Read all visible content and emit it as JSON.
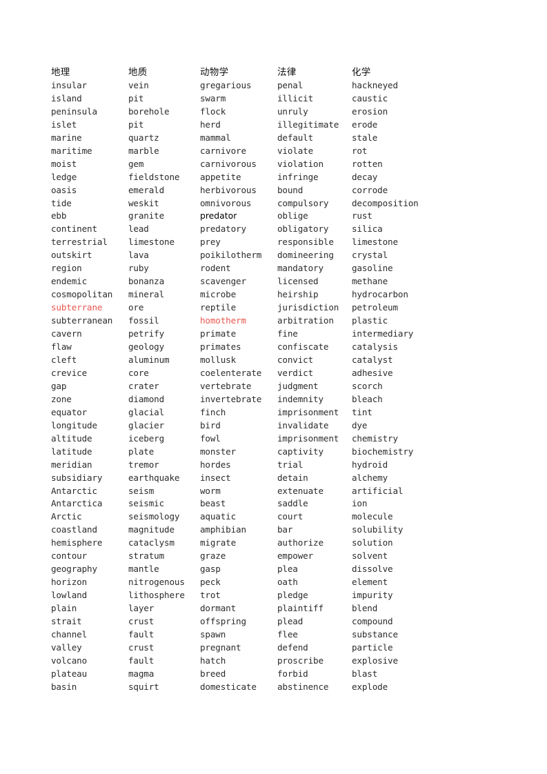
{
  "page": {
    "background_color": "#ffffff",
    "text_color": "#2b2b2b",
    "accent_red": "#e8564e",
    "column_count": 5,
    "row_count": 48
  },
  "columns": [
    {
      "header": "地理",
      "words": [
        "insular",
        "island",
        "peninsula",
        "islet",
        "marine",
        "maritime",
        "moist",
        "ledge",
        "oasis",
        "tide",
        "ebb",
        "continent",
        "terrestrial",
        "outskirt",
        "region",
        "endemic",
        "cosmopolitan",
        "subterrane",
        "subterranean",
        "cavern",
        "flaw",
        "cleft",
        "crevice",
        "gap",
        "zone",
        "equator",
        "longitude",
        "altitude",
        "latitude",
        "meridian",
        "subsidiary",
        "Antarctic",
        "Antarctica",
        "Arctic",
        "coastland",
        "hemisphere",
        "contour",
        "geography",
        "horizon",
        "lowland",
        "plain",
        "strait",
        "channel",
        "valley",
        "volcano",
        "plateau",
        "basin",
        ""
      ]
    },
    {
      "header": "地质",
      "words": [
        "vein",
        "pit",
        "borehole",
        "pit",
        "quartz",
        "marble",
        "gem",
        "fieldstone",
        "emerald",
        "weskit",
        "granite",
        "lead",
        "limestone",
        "lava",
        "ruby",
        "bonanza",
        "mineral",
        "ore",
        "fossil",
        "petrify",
        "geology",
        "aluminum",
        "core",
        "crater",
        "diamond",
        "glacial",
        "glacier",
        "iceberg",
        "plate",
        "tremor",
        "earthquake",
        "seism",
        "seismic",
        "seismology",
        "magnitude",
        "cataclysm",
        "stratum",
        "mantle",
        "nitrogenous",
        "lithosphere",
        "layer",
        "crust",
        "fault",
        "crust",
        "fault",
        "magma",
        "squirt",
        ""
      ]
    },
    {
      "header": "动物学",
      "words": [
        "gregarious",
        "swarm",
        "flock",
        "herd",
        "mammal",
        "carnivore",
        "carnivorous",
        "appetite",
        "herbivorous",
        "omnivorous",
        "predator",
        "predatory",
        "prey",
        "poikilotherm",
        "rodent",
        "scavenger",
        "microbe",
        "reptile",
        "homotherm",
        "primate",
        "primates",
        "mollusk",
        "coelenterate",
        "vertebrate",
        "invertebrate",
        "finch",
        "bird",
        "fowl",
        "monster",
        "hordes",
        "insect",
        "worm",
        "beast",
        "aquatic",
        "amphibian",
        "migrate",
        "graze",
        "gasp",
        "peck",
        "trot",
        "dormant",
        "offspring",
        "spawn",
        "pregnant",
        "hatch",
        "breed",
        "domesticate",
        ""
      ]
    },
    {
      "header": "法律",
      "words": [
        "penal",
        "illicit",
        "unruly",
        "illegitimate",
        "default",
        "violate",
        "violation",
        "infringe",
        "bound",
        "compulsory",
        "oblige",
        "obligatory",
        "responsible",
        "domineering",
        "mandatory",
        "licensed",
        "heirship",
        "jurisdiction",
        "arbitration",
        "fine",
        "confiscate",
        "convict",
        "verdict",
        "judgment",
        "indemnity",
        "imprisonment",
        "invalidate",
        "imprisonment",
        "captivity",
        "trial",
        "detain",
        "extenuate",
        "saddle",
        "court",
        "bar",
        "authorize",
        "empower",
        "plea",
        "oath",
        "pledge",
        "plaintiff",
        "plead",
        "flee",
        "defend",
        "proscribe",
        "forbid",
        "abstinence",
        ""
      ]
    },
    {
      "header": "化学",
      "words": [
        "hackneyed",
        "caustic",
        "erosion",
        "erode",
        "stale",
        "rot",
        "rotten",
        "decay",
        "corrode",
        "decomposition",
        "rust",
        "silica",
        "limestone",
        "crystal",
        "gasoline",
        "methane",
        "hydrocarbon",
        "petroleum",
        "plastic",
        "intermediary",
        "catalysis",
        "catalyst",
        "adhesive",
        "scorch",
        "bleach",
        "tint",
        "dye",
        "chemistry",
        "biochemistry",
        "hydroid",
        "alchemy",
        "artificial",
        "ion",
        "molecule",
        "solubility",
        "solution",
        "solvent",
        "dissolve",
        "element",
        "impurity",
        "blend",
        "compound",
        "substance",
        "particle",
        "explosive",
        "blast",
        "explode",
        ""
      ]
    }
  ],
  "emphasis": {
    "red_words": [
      "subterrane",
      "homotherm"
    ],
    "bold_words": [
      "predator"
    ]
  }
}
